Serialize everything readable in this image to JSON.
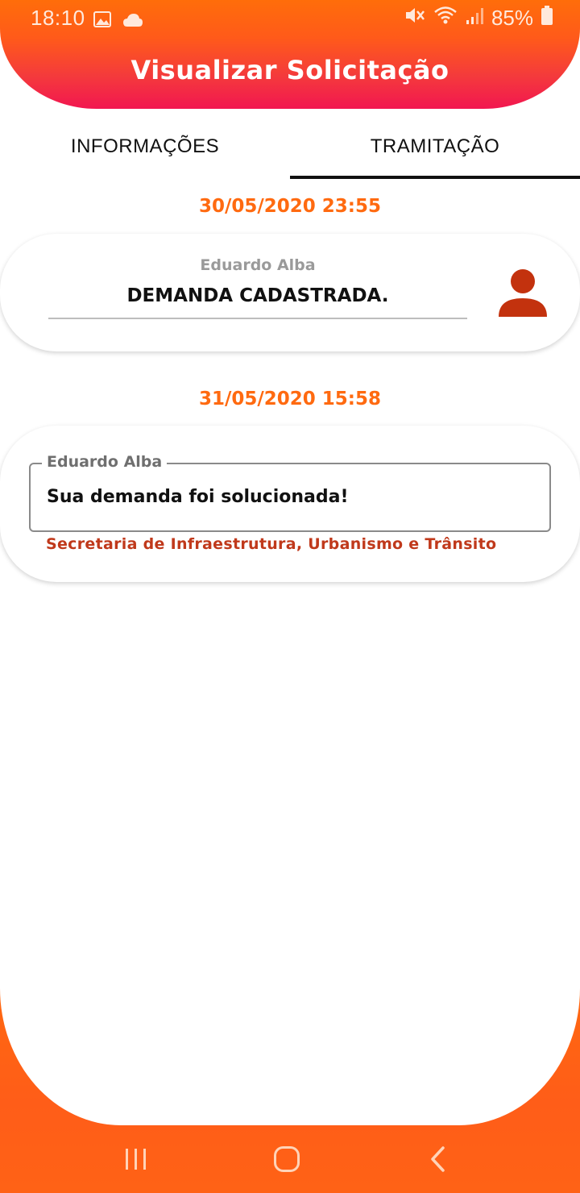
{
  "status_bar": {
    "time": "18:10",
    "battery": "85%"
  },
  "header": {
    "title": "Visualizar Solicitação"
  },
  "tabs": [
    {
      "label": "INFORMAÇÕES",
      "active": false
    },
    {
      "label": "TRAMITAÇÃO",
      "active": true
    }
  ],
  "entries": [
    {
      "datetime": "30/05/2020 23:55",
      "author": "Eduardo Alba",
      "message": "DEMANDA CADASTRADA."
    },
    {
      "datetime": "31/05/2020 15:58",
      "author": "Eduardo Alba",
      "message": "Sua demanda foi solucionada!",
      "department": "Secretaria de Infraestrutura, Urbanismo e Trânsito"
    }
  ],
  "colors": {
    "accent": "#ff6a10",
    "header_bottom": "#f21650",
    "department": "#c0391b",
    "avatar": "#c3320e"
  },
  "icons": {
    "status_left": [
      "image-icon",
      "cloud-icon"
    ],
    "status_right": [
      "mute-icon",
      "wifi-icon",
      "signal-icon",
      "battery-icon"
    ],
    "avatar": "person-icon",
    "nav": [
      "recents-icon",
      "home-icon",
      "back-icon"
    ]
  }
}
